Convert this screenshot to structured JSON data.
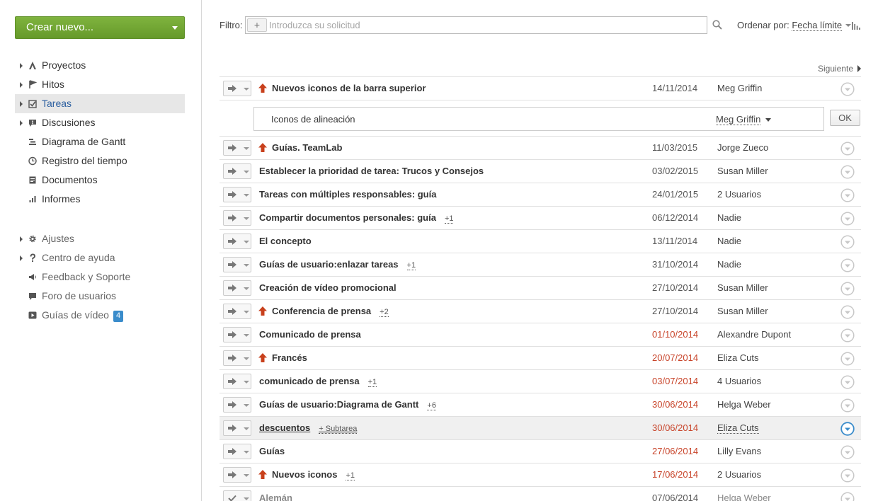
{
  "sidebar": {
    "create_label": "Crear nuevo...",
    "nav": [
      {
        "label": "Proyectos",
        "icon": "projects-icon"
      },
      {
        "label": "Hitos",
        "icon": "flag-icon"
      },
      {
        "label": "Tareas",
        "icon": "task-check-icon"
      },
      {
        "label": "Discusiones",
        "icon": "discussion-icon"
      },
      {
        "label": "Diagrama de Gantt",
        "icon": "gantt-icon"
      },
      {
        "label": "Registro del tiempo",
        "icon": "clock-icon"
      },
      {
        "label": "Documentos",
        "icon": "document-icon"
      },
      {
        "label": "Informes",
        "icon": "bar-chart-icon"
      }
    ],
    "secondary": [
      {
        "label": "Ajustes",
        "icon": "gear-icon"
      },
      {
        "label": "Centro de ayuda",
        "icon": "question-icon"
      },
      {
        "label": "Feedback y Soporte",
        "icon": "megaphone-icon"
      },
      {
        "label": "Foro de usuarios",
        "icon": "speech-bubble-icon"
      },
      {
        "label": "Guías de vídeo",
        "icon": "video-icon",
        "badge": "4"
      }
    ]
  },
  "filter": {
    "label": "Filtro:",
    "add": "+",
    "placeholder": "Introduzca su solicitud"
  },
  "sort": {
    "label": "Ordenar por:",
    "value": "Fecha límite"
  },
  "pager": {
    "next": "Siguiente"
  },
  "edit": {
    "value": "Iconos de alineación",
    "responsible": "Meg Griffin",
    "ok": "OK"
  },
  "colors": {
    "accent_green": "#6fa533",
    "overdue": "#c8442a",
    "priority": "#c8401c",
    "link_blue": "#2c5fa0",
    "status_active": "#3a8ccb"
  },
  "tasks": [
    {
      "title": "Nuevos iconos de la barra superior",
      "priority": true,
      "extra": "",
      "date": "14/11/2014",
      "overdue": false,
      "responsible": "Meg Griffin"
    },
    {
      "title": "Guías. TeamLab",
      "priority": true,
      "extra": "",
      "date": "11/03/2015",
      "overdue": false,
      "responsible": "Jorge Zueco"
    },
    {
      "title": "Establecer la prioridad de tarea: Trucos y Consejos",
      "priority": false,
      "extra": "",
      "date": "03/02/2015",
      "overdue": false,
      "responsible": "Susan Miller"
    },
    {
      "title": "Tareas con múltiples responsables: guía",
      "priority": false,
      "extra": "",
      "date": "24/01/2015",
      "overdue": false,
      "responsible": "2 Usuarios"
    },
    {
      "title": "Compartir documentos personales: guía",
      "priority": false,
      "extra": "+1",
      "date": "06/12/2014",
      "overdue": false,
      "responsible": "Nadie"
    },
    {
      "title": "El concepto",
      "priority": false,
      "extra": "",
      "date": "13/11/2014",
      "overdue": false,
      "responsible": "Nadie"
    },
    {
      "title": "Guías de usuario:enlazar tareas",
      "priority": false,
      "extra": "+1",
      "date": "31/10/2014",
      "overdue": false,
      "responsible": "Nadie"
    },
    {
      "title": "Creación de vídeo promocional",
      "priority": false,
      "extra": "",
      "date": "27/10/2014",
      "overdue": false,
      "responsible": "Susan Miller"
    },
    {
      "title": "Conferencia de prensa",
      "priority": true,
      "extra": "+2",
      "date": "27/10/2014",
      "overdue": false,
      "responsible": "Susan Miller"
    },
    {
      "title": "Comunicado de prensa",
      "priority": false,
      "extra": "",
      "date": "01/10/2014",
      "overdue": true,
      "responsible": "Alexandre Dupont"
    },
    {
      "title": "Francés",
      "priority": true,
      "extra": "",
      "date": "20/07/2014",
      "overdue": true,
      "responsible": "Eliza Cuts"
    },
    {
      "title": "comunicado de prensa",
      "priority": false,
      "extra": "+1",
      "date": "03/07/2014",
      "overdue": true,
      "responsible": "4 Usuarios"
    },
    {
      "title": "Guías de usuario:Diagrama de Gantt",
      "priority": false,
      "extra": "+6",
      "date": "30/06/2014",
      "overdue": true,
      "responsible": "Helga Weber"
    },
    {
      "title": "descuentos",
      "priority": false,
      "extra": "+ Subtarea",
      "date": "30/06/2014",
      "overdue": true,
      "responsible": "Eliza Cuts",
      "highlight": true
    },
    {
      "title": "Guías",
      "priority": false,
      "extra": "",
      "date": "27/06/2014",
      "overdue": true,
      "responsible": "Lilly Evans"
    },
    {
      "title": "Nuevos iconos",
      "priority": true,
      "extra": "+1",
      "date": "17/06/2014",
      "overdue": true,
      "responsible": "2 Usuarios"
    },
    {
      "title": "Alemán",
      "priority": false,
      "extra": "",
      "date": "07/06/2014",
      "overdue": false,
      "responsible": "Helga Weber",
      "done": true
    }
  ]
}
